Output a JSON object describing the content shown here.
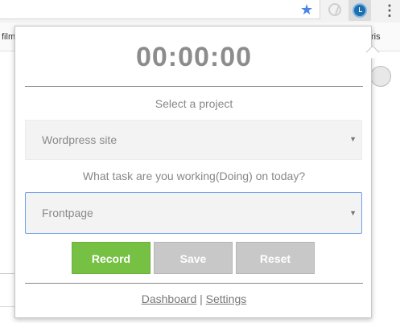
{
  "browser": {
    "bookmark_left": "film",
    "bookmark_right": "ris",
    "icons": [
      "star-icon",
      "extension-icon",
      "clock-extension-icon",
      "kebab-menu-icon"
    ]
  },
  "popup": {
    "timer": "00:00:00",
    "project_label": "Select a project",
    "project_value": "Wordpress site",
    "task_label": "What task are you working(Doing) on today?",
    "task_value": "Frontpage",
    "buttons": {
      "record": "Record",
      "save": "Save",
      "reset": "Reset"
    },
    "footer": {
      "dashboard": "Dashboard",
      "separator": "|",
      "settings": "Settings"
    }
  },
  "colors": {
    "record": "#76c044",
    "secondary_button": "#c8c8c8",
    "focus_border": "#6fa0ea"
  }
}
